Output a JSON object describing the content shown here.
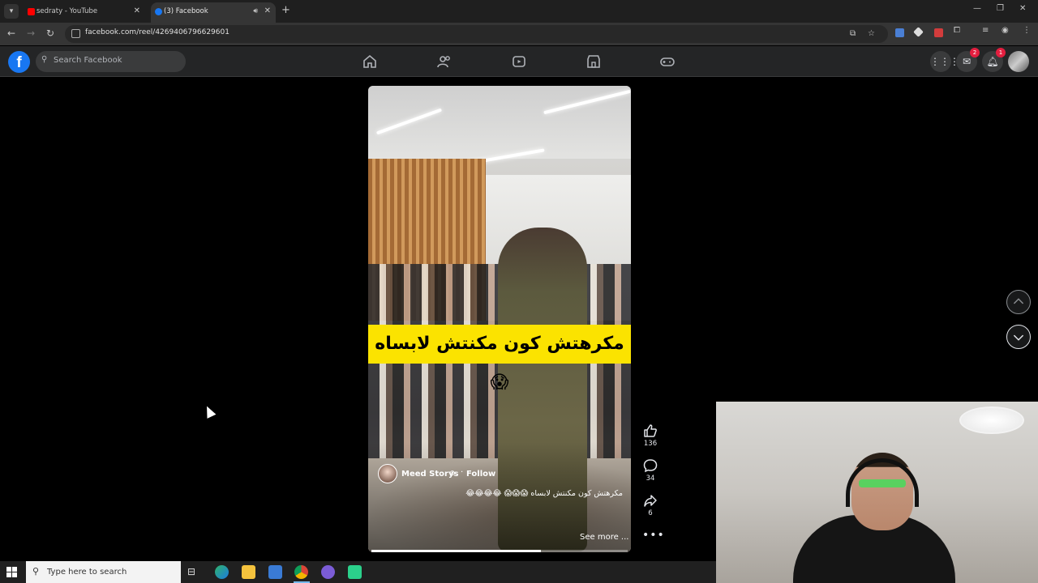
{
  "browser": {
    "tabs": [
      {
        "title": "sedraty - YouTube",
        "active": false
      },
      {
        "title": "(3) Facebook",
        "active": true
      }
    ],
    "url": "facebook.com/reel/4269406796629601"
  },
  "facebook": {
    "logo": "f",
    "search_placeholder": "Search Facebook",
    "badges": {
      "messenger": "2",
      "notifications": "1"
    }
  },
  "reel": {
    "overlay_caption": "مكرهتش كون مكنتش لابساه 😱",
    "author": "Meed Storys",
    "follow_label": "Follow",
    "description": "مكرهتش كون مكنتش لابساه 😱😱😱 😂😂😂😂",
    "see_more_label": "See more ...",
    "progress": 0.66
  },
  "actions": {
    "likes": "136",
    "comments": "34",
    "shares": "6"
  },
  "taskbar": {
    "search_placeholder": "Type here to search"
  },
  "colors": {
    "fb_blue": "#1877f2",
    "header_bg": "#242526",
    "badge_red": "#e41e3f",
    "caption_yellow": "#fbe300"
  }
}
